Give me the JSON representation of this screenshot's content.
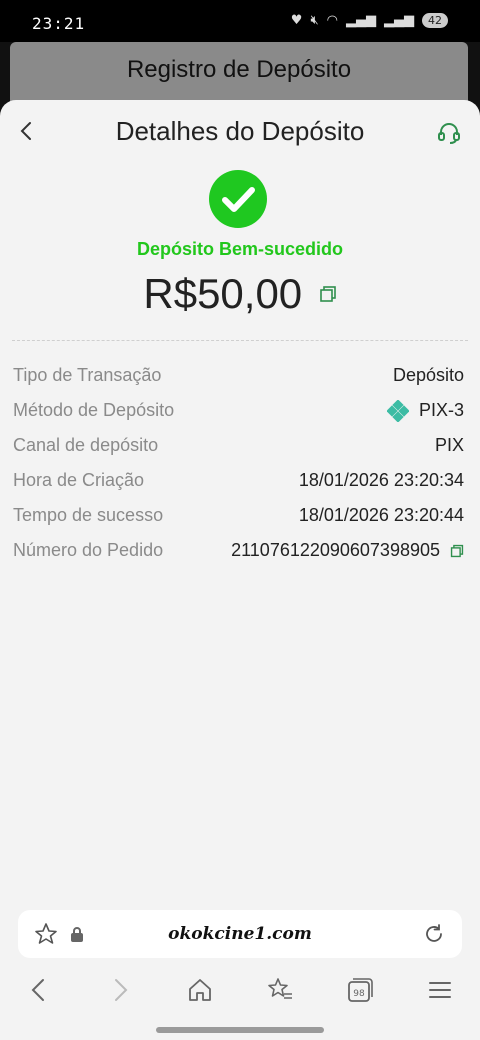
{
  "status_bar": {
    "time": "23:21",
    "battery": "42"
  },
  "background_page": {
    "title": "Registro de Depósito"
  },
  "header": {
    "title": "Detalhes do Depósito"
  },
  "result": {
    "status": "Depósito Bem-sucedido",
    "amount": "R$50,00",
    "status_color": "#22c71c"
  },
  "details": [
    {
      "label": "Tipo de Transação",
      "value": "Depósito"
    },
    {
      "label": "Método de Depósito",
      "value": "PIX-3"
    },
    {
      "label": "Canal de depósito",
      "value": "PIX"
    },
    {
      "label": "Hora de Criação",
      "value": "18/01/2026 23:20:34"
    },
    {
      "label": "Tempo de sucesso",
      "value": "18/01/2026 23:20:44"
    },
    {
      "label": "Número do Pedido",
      "value": "211076122090607398905"
    }
  ],
  "browser": {
    "url": "okokcine1.com"
  },
  "icons": [
    "back-icon",
    "headset-icon",
    "check-icon",
    "copy-icon",
    "pix-icon",
    "star-icon",
    "lock-icon",
    "reload-icon",
    "home-icon",
    "bookmarks-icon",
    "tabs-icon",
    "menu-icon"
  ]
}
